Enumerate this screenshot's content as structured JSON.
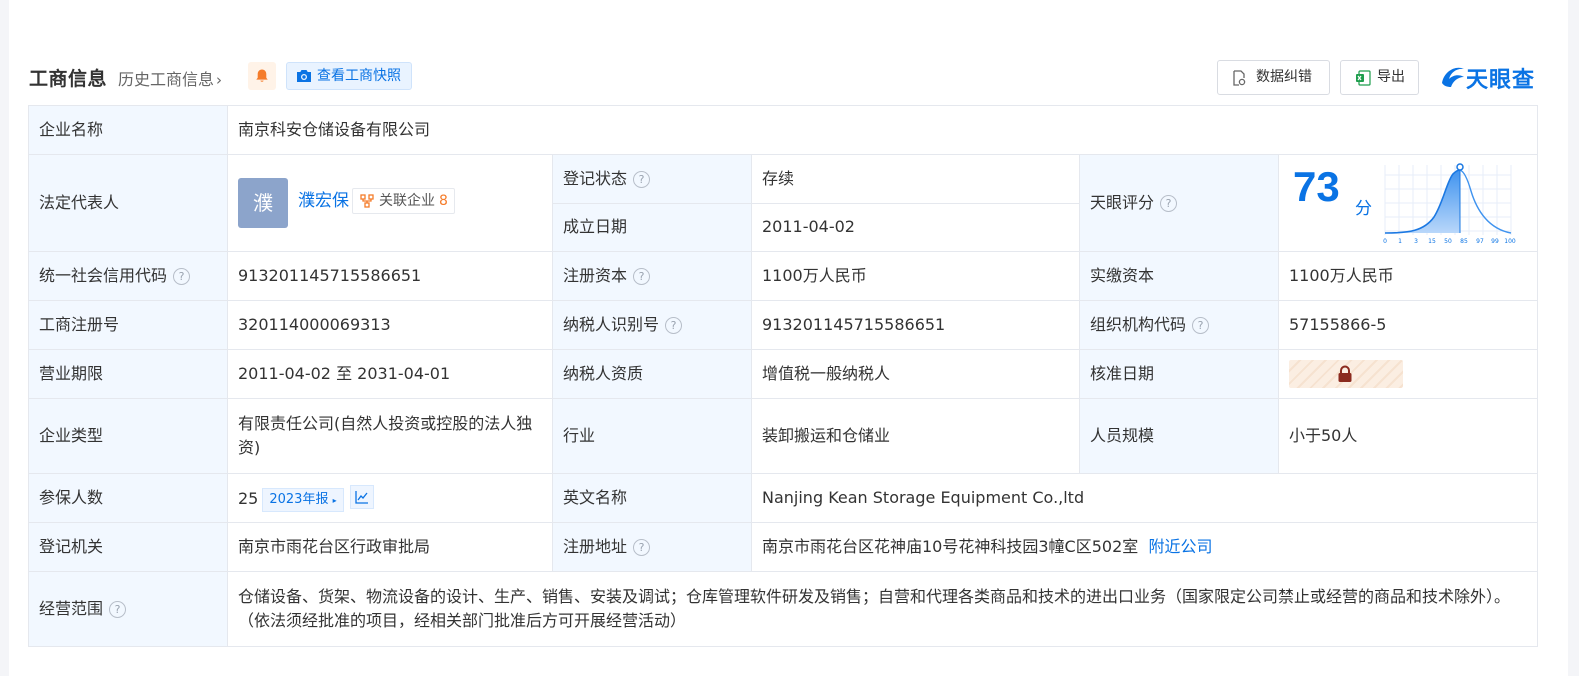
{
  "header": {
    "title": "工商信息",
    "history_link": "历史工商信息",
    "snapshot_button": "查看工商快照",
    "correct_button": "数据纠错",
    "export_button": "导出",
    "logo_text": "天眼查"
  },
  "rows": {
    "company_name": {
      "label": "企业名称",
      "value": "南京科安仓储设备有限公司"
    },
    "legal_rep": {
      "label": "法定代表人",
      "avatar_char": "濮",
      "name": "濮宏保",
      "related_label": "关联企业",
      "related_count": "8"
    },
    "reg_status": {
      "label": "登记状态",
      "value": "存续"
    },
    "founded": {
      "label": "成立日期",
      "value": "2011-04-02"
    },
    "score": {
      "label": "天眼评分",
      "value": "73",
      "unit": "分",
      "axis_ticks": [
        "0",
        "1",
        "3",
        "15",
        "50",
        "85",
        "97",
        "99",
        "100"
      ]
    },
    "credit_code": {
      "label": "统一社会信用代码",
      "value": "913201145715586651"
    },
    "reg_capital": {
      "label": "注册资本",
      "value": "1100万人民币"
    },
    "paid_capital": {
      "label": "实缴资本",
      "value": "1100万人民币"
    },
    "reg_number": {
      "label": "工商注册号",
      "value": "320114000069313"
    },
    "tax_id": {
      "label": "纳税人识别号",
      "value": "913201145715586651"
    },
    "org_code": {
      "label": "组织机构代码",
      "value": "57155866-5"
    },
    "term": {
      "label": "营业期限",
      "value": "2011-04-02 至 2031-04-01"
    },
    "tax_qual": {
      "label": "纳税人资质",
      "value": "增值税一般纳税人"
    },
    "approve_date": {
      "label": "核准日期"
    },
    "company_type": {
      "label": "企业类型",
      "value": "有限责任公司(自然人投资或控股的法人独资)"
    },
    "industry": {
      "label": "行业",
      "value": "装卸搬运和仓储业"
    },
    "staff": {
      "label": "人员规模",
      "value": "小于50人"
    },
    "insured": {
      "label": "参保人数",
      "value": "25",
      "year_tag": "2023年报"
    },
    "english_name": {
      "label": "英文名称",
      "value": "Nanjing Kean Storage Equipment Co.,ltd"
    },
    "authority": {
      "label": "登记机关",
      "value": "南京市雨花台区行政审批局"
    },
    "address": {
      "label": "注册地址",
      "value": "南京市雨花台区花神庙10号花神科技园3幢C区502室",
      "nearby_link": "附近公司"
    },
    "scope": {
      "label": "经营范围",
      "value": "仓储设备、货架、物流设备的设计、生产、销售、安装及调试；仓库管理软件研发及销售；自营和代理各类商品和技术的进出口业务（国家限定公司禁止或经营的商品和技术除外）。（依法须经批准的项目，经相关部门批准后方可开展经营活动）"
    }
  },
  "colors": {
    "accent": "#0a73e4",
    "label_bg": "#f2f8ff",
    "status_green": "#1e9e4d",
    "orange": "#f57c2a"
  }
}
